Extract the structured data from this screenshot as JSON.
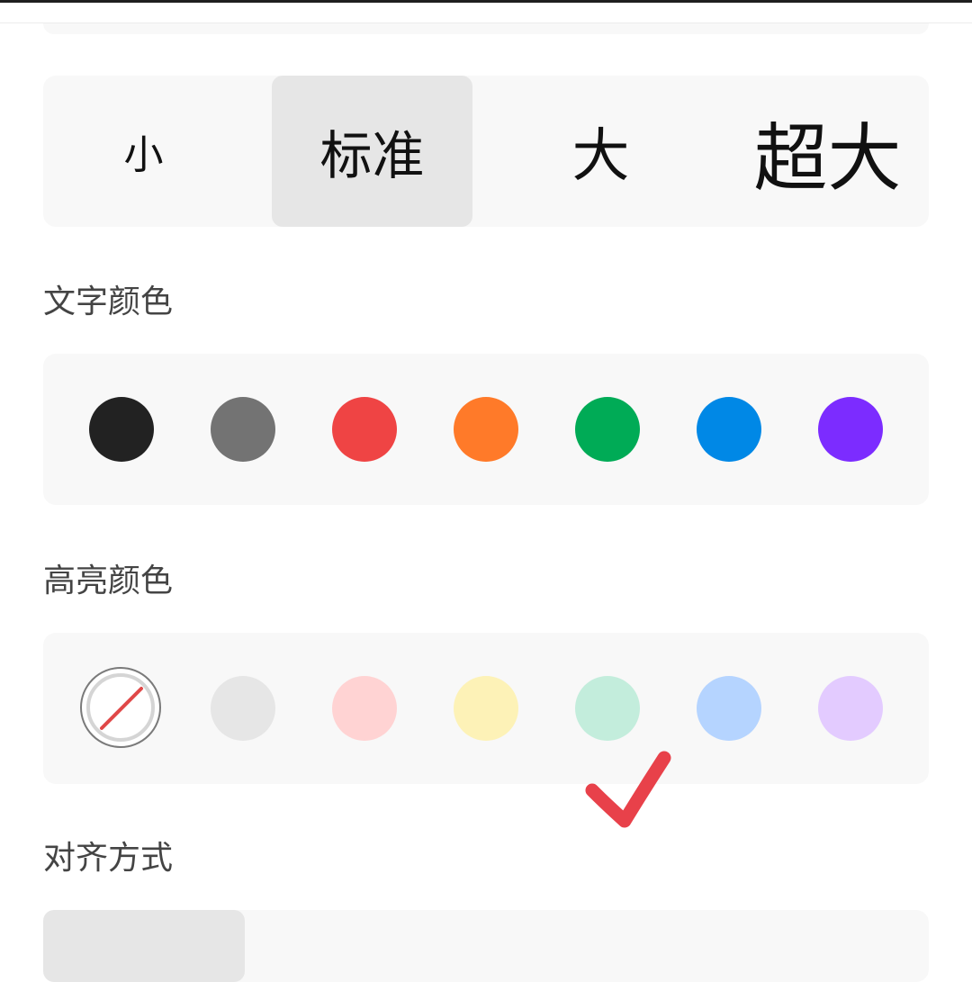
{
  "font_size": {
    "options": [
      "小",
      "标准",
      "大",
      "超大"
    ],
    "selected": "标准"
  },
  "text_color": {
    "title": "文字颜色",
    "swatches": [
      "#222222",
      "#737373",
      "#ef4444",
      "#ff7a29",
      "#00ab56",
      "#0088e6",
      "#7c2cff"
    ]
  },
  "highlight_color": {
    "title": "高亮颜色",
    "none_icon": "no-color-icon",
    "swatches": [
      "#e6e6e6",
      "#ffd3d3",
      "#fdf2b7",
      "#c3eddc",
      "#b5d4ff",
      "#e3cbff"
    ]
  },
  "alignment": {
    "title": "对齐方式"
  },
  "annotation": {
    "icon": "checkmark-icon",
    "color": "#e8414a"
  }
}
